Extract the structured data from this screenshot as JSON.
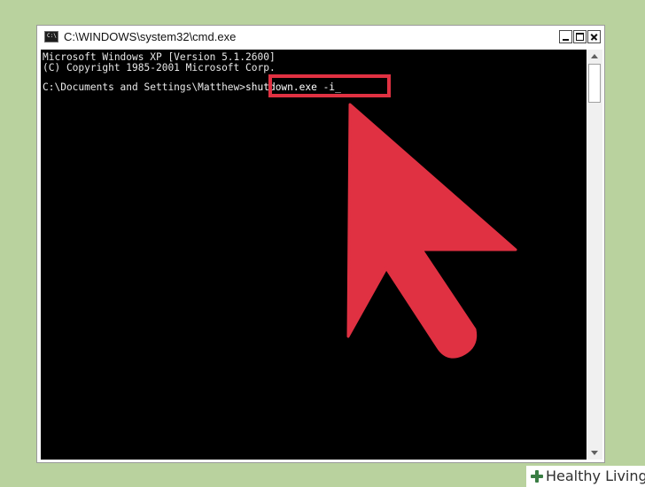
{
  "window": {
    "title": "C:\\WINDOWS\\system32\\cmd.exe",
    "icon_label": "C:\\"
  },
  "console": {
    "line1": "Microsoft Windows XP [Version 5.1.2600]",
    "line2": "(C) Copyright 1985-2001 Microsoft Corp.",
    "prompt": "C:\\Documents and Settings\\Matthew>",
    "command": "shutdown.exe -i",
    "cursor": "_"
  },
  "colors": {
    "background": "#b9d29e",
    "highlight": "#e03142",
    "console_bg": "#000000",
    "console_text": "#e8e8e8"
  },
  "watermark": {
    "icon": "plus-icon",
    "text": "Healthy Living"
  }
}
